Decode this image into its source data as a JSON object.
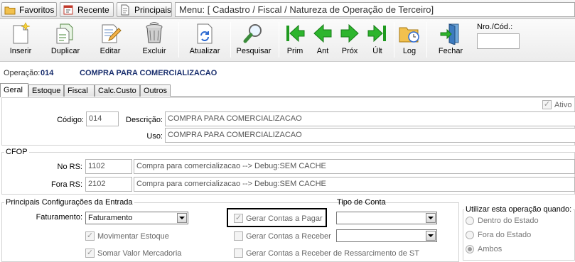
{
  "nav": {
    "favoritos": "Favoritos",
    "recente": "Recente",
    "principais": "Principais",
    "menu_path": "Menu: [ Cadastro / Fiscal / Natureza de Operação de Terceiro]"
  },
  "toolbar": {
    "inserir": "Inserir",
    "duplicar": "Duplicar",
    "editar": "Editar",
    "excluir": "Excluir",
    "atualizar": "Atualizar",
    "pesquisar": "Pesquisar",
    "prim": "Prim",
    "ant": "Ant",
    "prox": "Próx",
    "ult": "Últ",
    "log": "Log",
    "fechar": "Fechar",
    "nro_label": "Nro./Cód.:",
    "nro_value": ""
  },
  "operation": {
    "label": "Operação:",
    "code": "014",
    "description": "COMPRA PARA COMERCIALIZACAO"
  },
  "tabs": [
    "Geral",
    "Estoque",
    "Fiscal",
    "Calc.Custo",
    "Outros"
  ],
  "general": {
    "ativo_label": "Ativo",
    "ativo_checked": true,
    "codigo_label": "Código:",
    "codigo_value": "014",
    "descricao_label": "Descrição:",
    "descricao_value": "COMPRA PARA COMERCIALIZACAO",
    "uso_label": "Uso:",
    "uso_value": "COMPRA PARA COMERCIALIZACAO"
  },
  "cfop": {
    "title": "CFOP",
    "no_rs_label": "No RS:",
    "no_rs_code": "1102",
    "no_rs_desc": "Compra para comercializacao   --> Debug:SEM CACHE",
    "fora_rs_label": "Fora RS:",
    "fora_rs_code": "2102",
    "fora_rs_desc": "Compra para comercializacao   --> Debug:SEM CACHE"
  },
  "config": {
    "title": "Principais Configurações da Entrada",
    "faturamento_label": "Faturamento:",
    "faturamento_value": "Faturamento",
    "movimentar_estoque": "Movimentar Estoque",
    "somar_valor": "Somar Valor Mercadoria",
    "gerar_pagar": "Gerar Contas a Pagar",
    "gerar_receber": "Gerar Contas a Receber",
    "gerar_ressarcimento": "Gerar Contas a Receber de Ressarcimento de ST",
    "tipo_conta_title": "Tipo de Conta",
    "tipo_conta_1": "",
    "tipo_conta_2": "",
    "utilizar_title": "Utilizar esta operação quando:",
    "dentro_estado": "Dentro do  Estado",
    "fora_estado": "Fora do Estado",
    "ambos": "Ambos"
  },
  "colors": {
    "operation_text": "#1a2f6e",
    "toolbar_bg": "#ececec",
    "green_arrow": "#1f9a1f"
  }
}
